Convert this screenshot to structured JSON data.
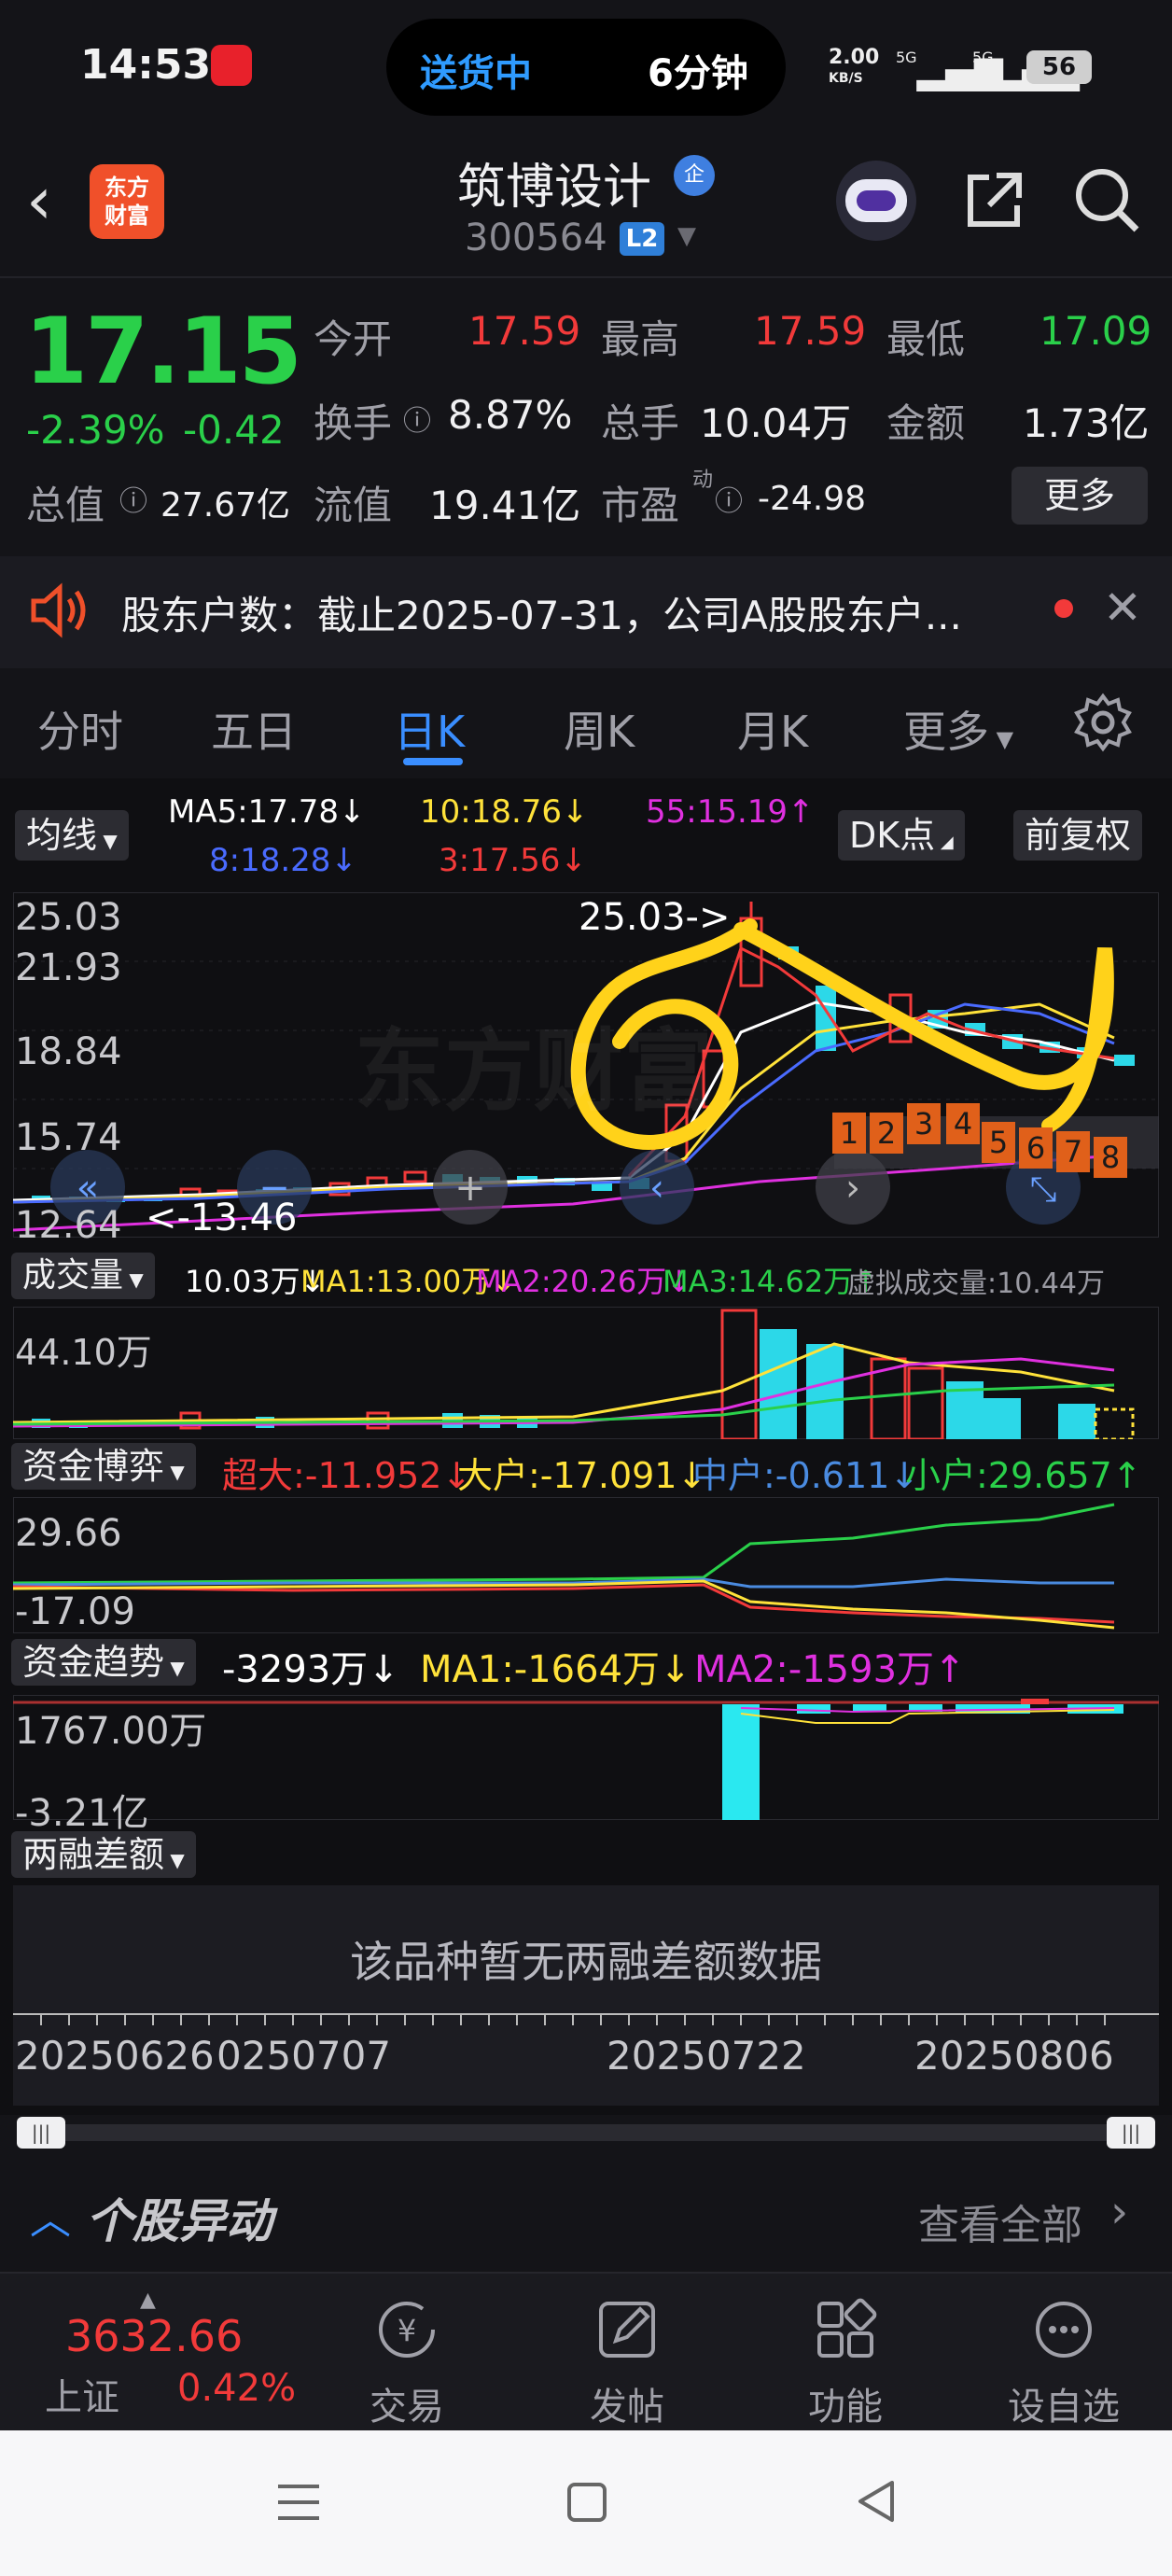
{
  "status": {
    "time": "14:53",
    "pill_left": "送货中",
    "pill_right": "6分钟",
    "net_speed": "2.00",
    "net_unit": "KB/S",
    "signal1": "5G",
    "signal2": "5G",
    "battery": "56"
  },
  "header": {
    "logo_line1": "东方",
    "logo_line2": "财富",
    "stock_name": "筑博设计",
    "qi_badge": "企",
    "stock_code": "300564",
    "level_badge": "L2"
  },
  "quote": {
    "price": "17.15",
    "change_pct": "-2.39%",
    "change_amt": "-0.42",
    "open_label": "今开",
    "open": "17.59",
    "high_label": "最高",
    "high": "17.59",
    "low_label": "最低",
    "low": "17.09",
    "turnover_label": "换手",
    "turnover": "8.87%",
    "volume_label": "总手",
    "volume": "10.04万",
    "amount_label": "金额",
    "amount": "1.73亿",
    "mktcap_label": "总值",
    "mktcap": "27.67亿",
    "float_label": "流值",
    "float": "19.41亿",
    "pe_label": "市盈",
    "pe_sup": "动",
    "pe": "-24.98",
    "more_button": "更多"
  },
  "notice": {
    "text": "股东户数：截止2025-07-31，公司A股股东户..."
  },
  "tabs": [
    "分时",
    "五日",
    "日K",
    "周K",
    "月K",
    "更多"
  ],
  "kline": {
    "ma_selector": "均线",
    "ma5": "MA5:17.78↓",
    "ma10": "10:18.76↓",
    "ma55": "55:15.19↑",
    "ma8": "8:18.28↓",
    "ma3": "3:17.56↓",
    "dk_button": "DK点",
    "fq_button": "前复权",
    "y_labels": [
      "25.03",
      "21.93",
      "18.84",
      "15.74",
      "12.64"
    ],
    "high_marker": "25.03->",
    "low_marker": "<-13.46",
    "watermark": "东方财富",
    "dk_counts": [
      "1",
      "2",
      "3",
      "4",
      "5",
      "6",
      "7",
      "8"
    ]
  },
  "volume": {
    "selector": "成交量",
    "cur": "10.03万↓",
    "ma1": "MA1:13.00万↓",
    "ma2": "MA2:20.26万↓",
    "ma3": "MA3:14.62万↑",
    "virtual": "虚拟成交量:10.44万",
    "y_label": "44.10万"
  },
  "capital_game": {
    "selector": "资金博弈",
    "super": "超大:-11.952↓",
    "large": "大户:-17.091↓",
    "mid": "中户:-0.611↓",
    "small": "小户:29.657↑",
    "y_top": "29.66",
    "y_bottom": "-17.09"
  },
  "capital_trend": {
    "selector": "资金趋势",
    "cur": "-3293万↓",
    "ma1": "MA1:-1664万↓",
    "ma2": "MA2:-1593万↑",
    "y_top": "1767.00万",
    "y_bottom": "-3.21亿"
  },
  "margin": {
    "selector": "两融差额",
    "empty_text": "该品种暂无两融差额数据"
  },
  "dates": [
    "20250626",
    "0250707",
    "20250722",
    "20250806"
  ],
  "movement": {
    "title": "个股异动",
    "view_all": "查看全部"
  },
  "bottom_nav": {
    "index_value": "3632.66",
    "index_name": "上证",
    "index_pct": "0.42%",
    "items": [
      "交易",
      "发帖",
      "功能",
      "设自选"
    ]
  },
  "colors": {
    "up": "#f23a3a",
    "down": "#2ad04a",
    "accent": "#3a8eff",
    "ma5": "#ffffff",
    "ma10": "#ffe23a",
    "ma55": "#e030e0",
    "ma8": "#3b5bff",
    "ma3": "#f23a3a",
    "annotation": "#ffd21a"
  }
}
